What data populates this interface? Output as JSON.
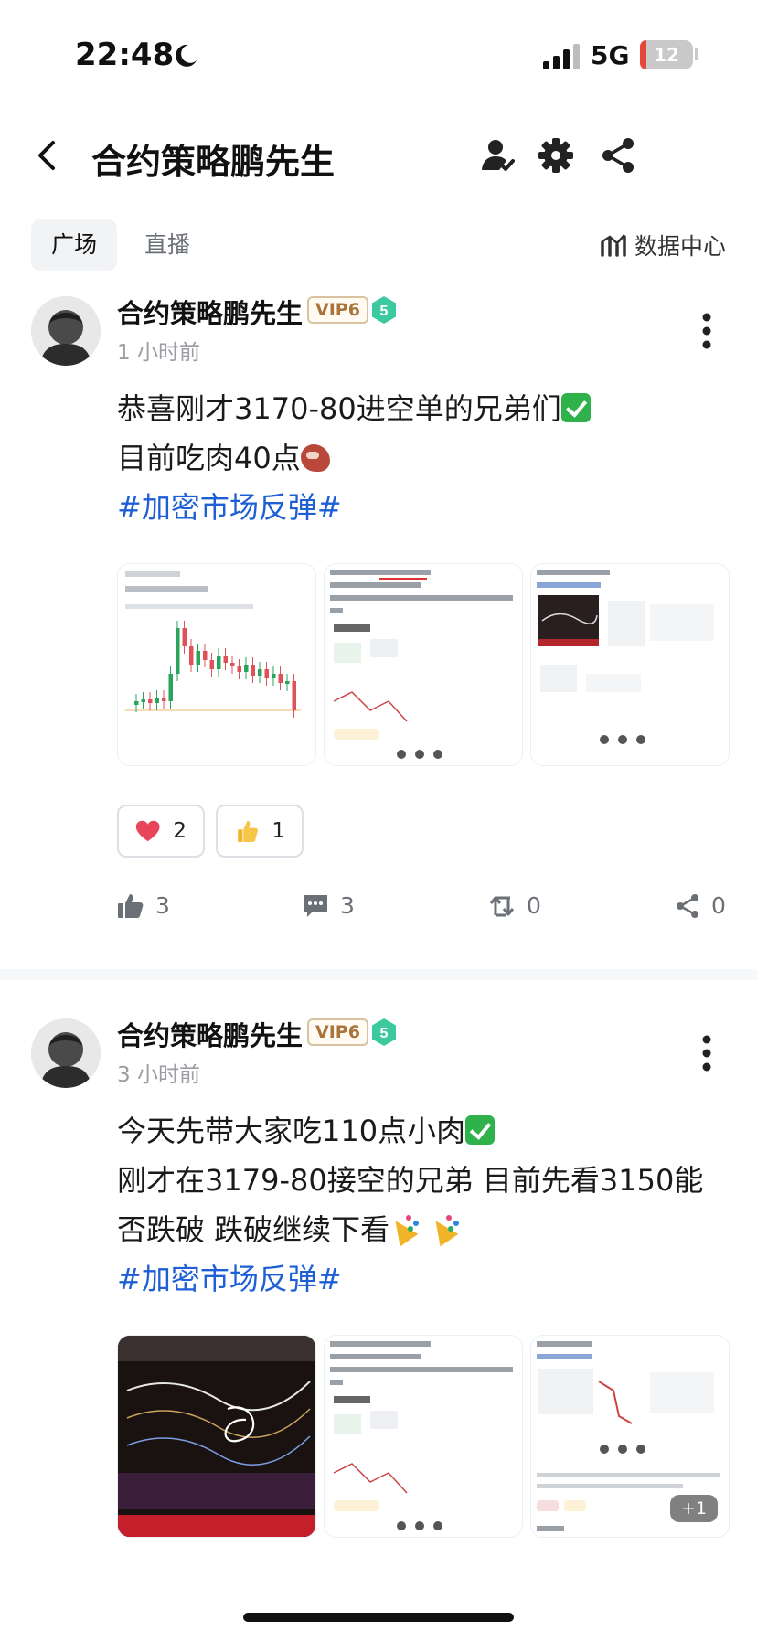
{
  "status": {
    "time": "22:48",
    "network": "5G",
    "battery": "12",
    "battery_level_percent": 12
  },
  "nav": {
    "title": "合约策略鹏先生"
  },
  "tabs": [
    {
      "label": "广场",
      "active": true
    },
    {
      "label": "直播",
      "active": false
    }
  ],
  "data_center": {
    "label": "数据中心"
  },
  "posts": [
    {
      "author": "合约策略鹏先生",
      "vip": "VIP6",
      "level": "5",
      "time": "1 小时前",
      "lines": [
        "恭喜刚才3170-80进空单的兄弟们",
        "目前吃肉40点"
      ],
      "hashtag": "#加密市场反弹#",
      "reactions": [
        {
          "icon": "heart-icon",
          "count": "2"
        },
        {
          "icon": "thumbs-up-emoji-icon",
          "count": "1"
        }
      ],
      "stats": {
        "likes": "3",
        "comments": "3",
        "reposts": "0",
        "shares": "0"
      }
    },
    {
      "author": "合约策略鹏先生",
      "vip": "VIP6",
      "level": "5",
      "time": "3 小时前",
      "lines": [
        "今天先带大家吃110点小肉",
        "刚才在3179-80接空的兄弟 目前先看3150能",
        "否跌破 跌破继续下看"
      ],
      "hashtag": "#加密市场反弹#",
      "more_images": "+1"
    }
  ],
  "colors": {
    "hashtag": "#1e5fd6",
    "vip_text": "#a8743a",
    "level_badge": "#3cc9a0",
    "candle_up": "#2aa45b",
    "candle_down": "#e0525a"
  }
}
